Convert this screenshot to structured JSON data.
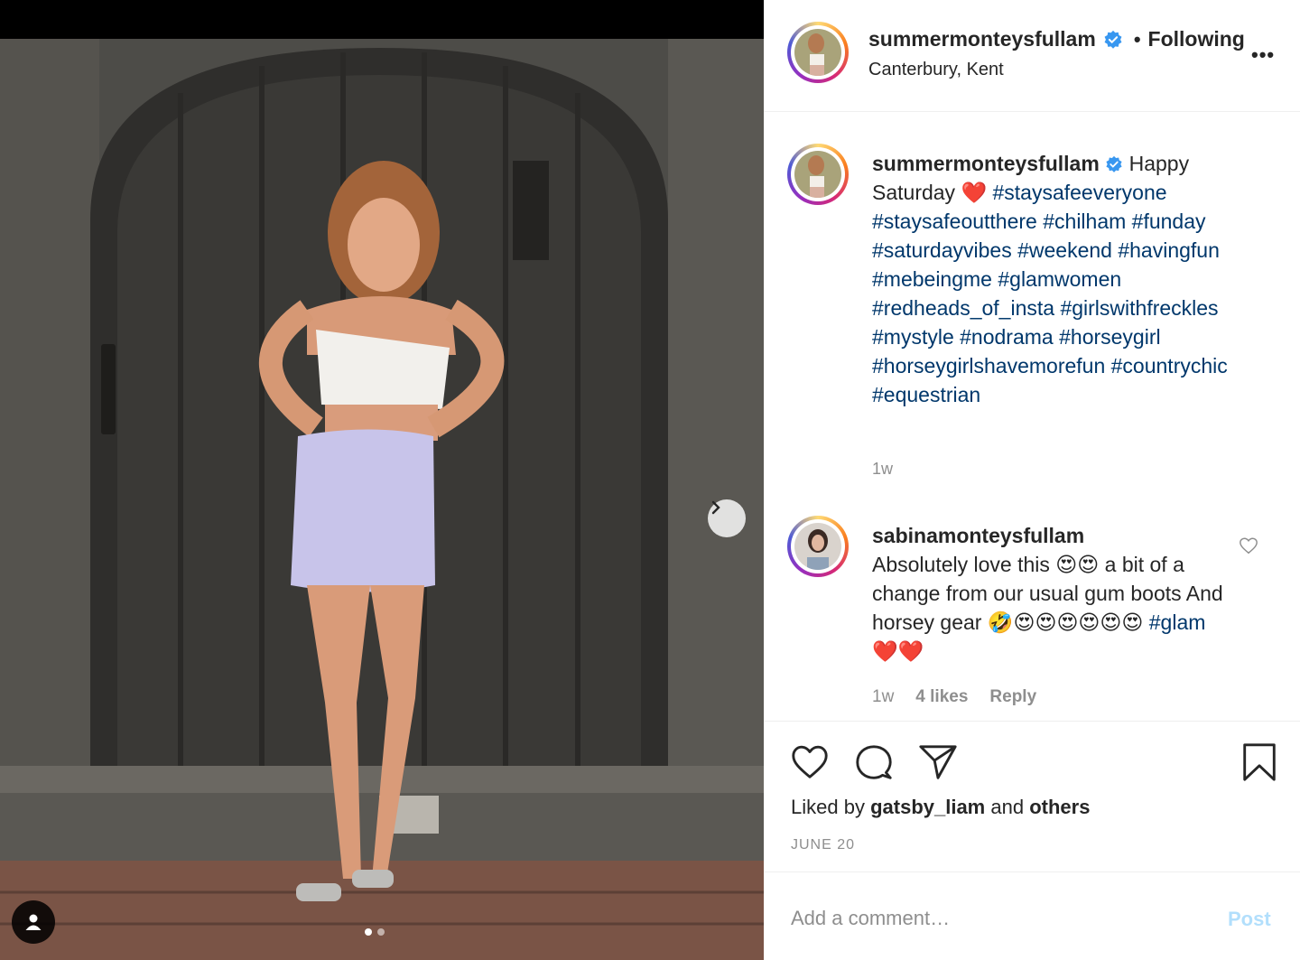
{
  "post": {
    "username": "summermonteysfullam",
    "location": "Canterbury, Kent",
    "follow_status": "Following",
    "separator": "•",
    "more_label": "•••"
  },
  "caption": {
    "username": "summermonteysfullam",
    "text_before": "Happy Saturday",
    "emoji": "❤️",
    "hashtags": [
      "#staysafeeveryone",
      "#staysafeoutthere",
      "#chilham",
      "#funday",
      "#saturdayvibes",
      "#weekend",
      "#havingfun",
      "#mebeingme",
      "#glamwomen",
      "#redheads_of_insta",
      "#girlswithfreckles",
      "#mystyle",
      "#nodrama",
      "#horseygirl",
      "#horseygirlshavemorefun",
      "#countrychic",
      "#equestrian"
    ],
    "time": "1w"
  },
  "comment": {
    "username": "sabinamonteysfullam",
    "text_1": "Absolutely love this",
    "emoji_1": "😍😍",
    "text_2": "a bit of a change from our usual gum boots And horsey gear",
    "emoji_2": "🤣😍😍😍😍😍😍",
    "hashtag": "#glam",
    "emoji_3": "❤️❤️",
    "time": "1w",
    "likes": "4 likes",
    "reply": "Reply"
  },
  "actions": {
    "liked_by_prefix": "Liked by",
    "liked_by_user": "gatsby_liam",
    "liked_by_and": "and",
    "liked_by_others": "others",
    "date": "JUNE 20"
  },
  "add_comment": {
    "placeholder": "Add a comment…",
    "post_label": "Post"
  },
  "colors": {
    "hashtag": "#00376b",
    "verified": "#3897f0",
    "post_disabled": "#b2dffc",
    "muted": "#8e8e8e"
  },
  "icons": {
    "like": "heart-icon",
    "comment": "comment-icon",
    "share": "share-icon",
    "save": "bookmark-icon",
    "next": "chevron-right-icon",
    "tag": "user-tag-icon",
    "verified": "verified-badge-icon"
  },
  "carousel": {
    "total": 2,
    "current": 1
  }
}
